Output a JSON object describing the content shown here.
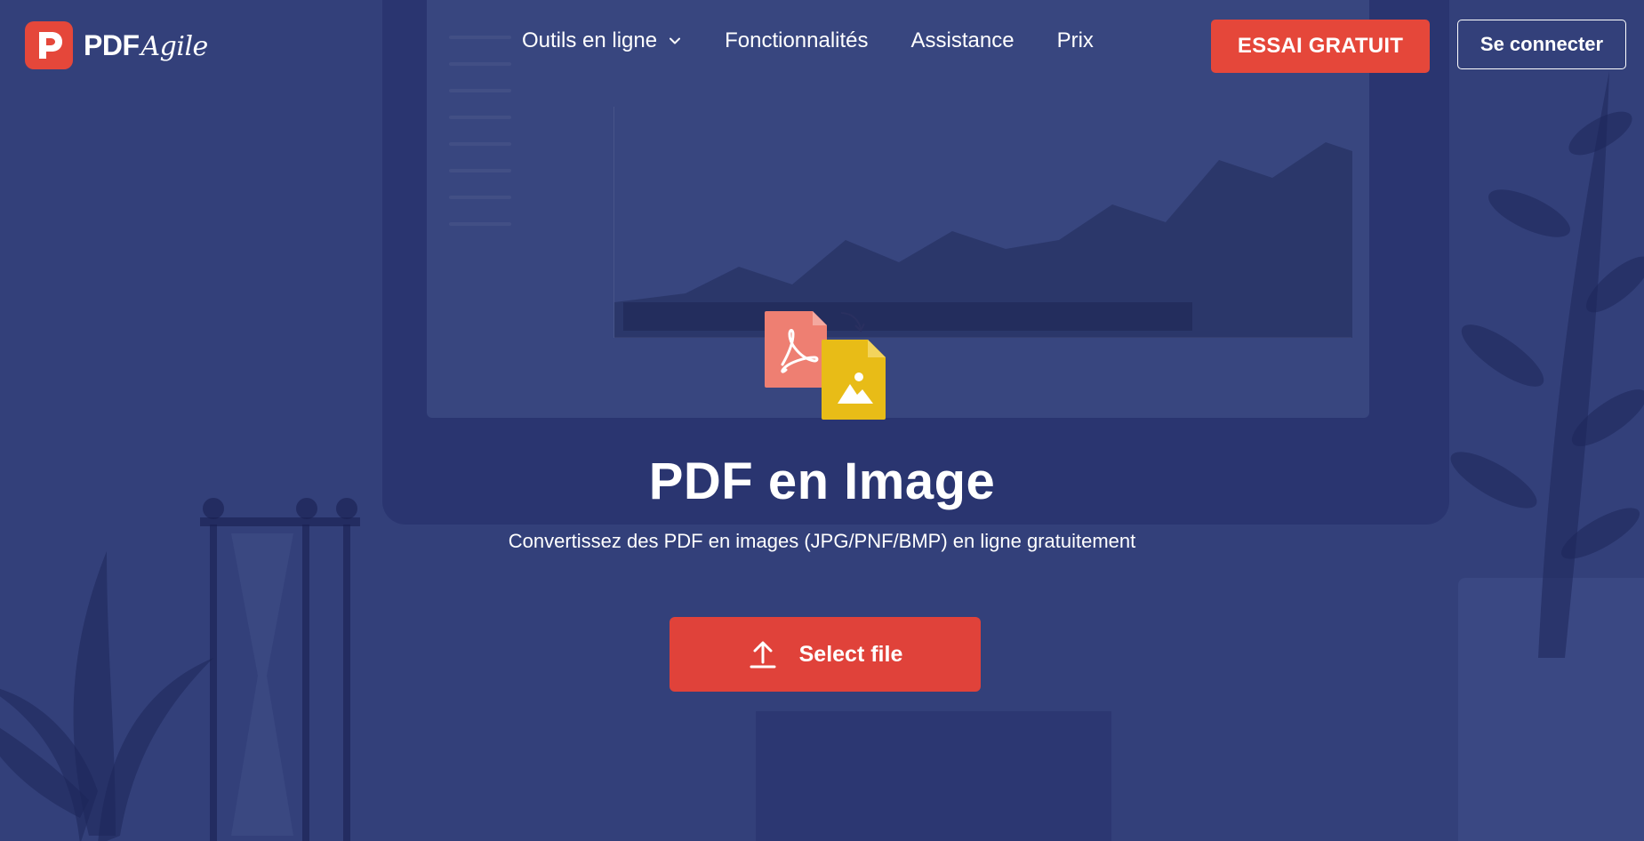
{
  "brand": {
    "name_bold": "PDF",
    "name_script": "Agile",
    "accent_color": "#e5473a",
    "background_color": "#33407a"
  },
  "nav": {
    "items": [
      {
        "label": "Outils en ligne",
        "has_dropdown": true
      },
      {
        "label": "Fonctionnalités"
      },
      {
        "label": "Assistance"
      },
      {
        "label": "Prix"
      }
    ],
    "trial_label": "ESSAI GRATUIT",
    "login_label": "Se connecter"
  },
  "hero": {
    "title": "PDF en Image",
    "subtitle": "Convertissez des PDF en images (JPG/PNF/BMP) en ligne gratuitement",
    "select_label": "Select file",
    "icons": [
      "pdf-file-icon",
      "image-file-icon",
      "upload-icon"
    ]
  }
}
